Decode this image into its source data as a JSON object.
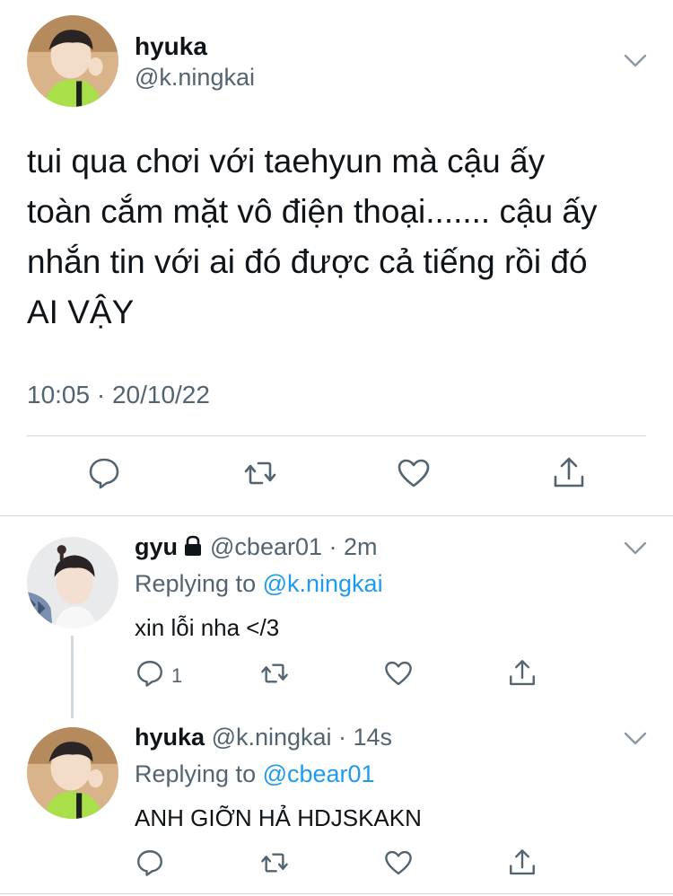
{
  "main_tweet": {
    "name": "hyuka",
    "handle": "@k.ningkai",
    "text_lines": [
      "tui qua chơi với taehyun mà cậu ấy",
      "toàn cắm mặt vô điện thoại....... cậu ấy",
      "nhắn tin với ai đó được cả tiếng rồi đó",
      "AI VẬY"
    ],
    "timestamp": "10:05 · 20/10/22",
    "icons": [
      "reply-icon",
      "retweet-icon",
      "like-icon",
      "share-icon"
    ]
  },
  "replies": [
    {
      "name": "gyu",
      "protected": true,
      "handle_time": "@cbear01 · 2m",
      "replying_prefix": "Replying to ",
      "replying_to": "@k.ningkai",
      "text": "xin lỗi nha </3",
      "reply_count": "1"
    },
    {
      "name": "hyuka",
      "protected": false,
      "handle_time": "@k.ningkai · 14s",
      "replying_prefix": "Replying to ",
      "replying_to": "@cbear01",
      "text": "ANH GIỠN HẢ HDJSKAKN",
      "reply_count": ""
    }
  ],
  "colors": {
    "text": "#0f1419",
    "secondary": "#536471",
    "link": "#1d9bf0",
    "divider": "#cfd9de"
  }
}
